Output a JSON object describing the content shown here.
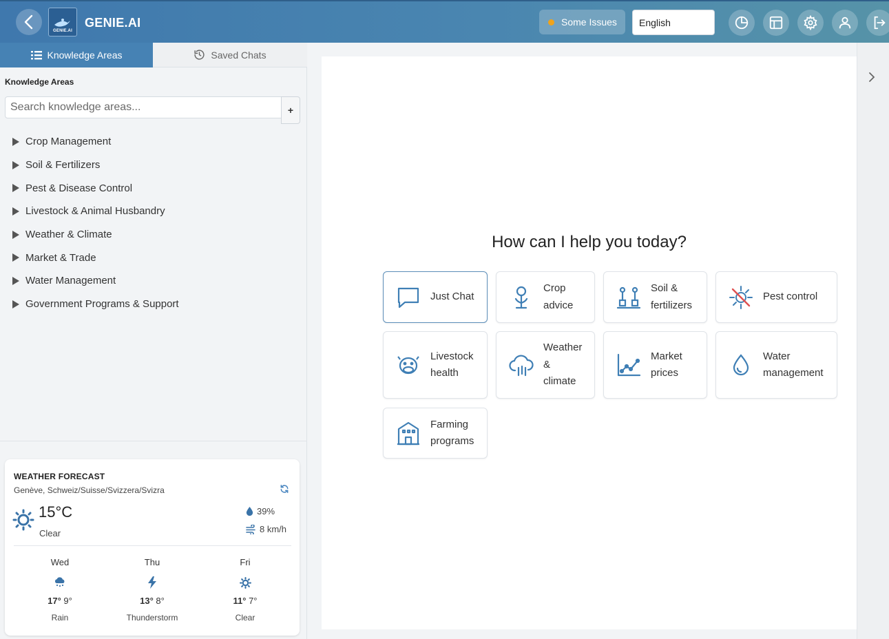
{
  "header": {
    "brand": "GENIE.AI",
    "logo_text": "GENIE.AI",
    "status_label": "Some Issues",
    "status_color": "#f0a31a",
    "language": "English",
    "icons": [
      "back-icon",
      "chart-icon",
      "layout-icon",
      "gear-icon",
      "user-icon",
      "logout-icon"
    ]
  },
  "sidebar": {
    "tabs": [
      {
        "label": "Knowledge Areas",
        "icon": "list-icon",
        "active": true
      },
      {
        "label": "Saved Chats",
        "icon": "history-icon",
        "active": false
      }
    ],
    "section_title": "Knowledge Areas",
    "search_placeholder": "Search knowledge areas...",
    "add_label": "+",
    "knowledge_areas": [
      "Crop Management",
      "Soil & Fertilizers",
      "Pest & Disease Control",
      "Livestock & Animal Husbandry",
      "Weather & Climate",
      "Market & Trade",
      "Water Management",
      "Government Programs & Support"
    ]
  },
  "weather": {
    "title": "WEATHER FORECAST",
    "location": "Genève, Schweiz/Suisse/Svizzera/Svizra",
    "temperature": "15°C",
    "condition": "Clear",
    "humidity": "39%",
    "wind": "8 km/h",
    "forecast": [
      {
        "day": "Wed",
        "icon": "rain-icon",
        "high": "17°",
        "low": "9°",
        "condition": "Rain"
      },
      {
        "day": "Thu",
        "icon": "thunderstorm-icon",
        "high": "13°",
        "low": "8°",
        "condition": "Thunderstorm"
      },
      {
        "day": "Fri",
        "icon": "sun-icon",
        "high": "11°",
        "low": "7°",
        "condition": "Clear"
      }
    ]
  },
  "main": {
    "greeting": "How can I help you today?",
    "cards": [
      {
        "label_lines": [
          "Just Chat"
        ],
        "icon": "chat-icon",
        "selected": true
      },
      {
        "label_lines": [
          "Crop",
          "advice"
        ],
        "icon": "sprout-icon",
        "selected": false
      },
      {
        "label_lines": [
          "Soil &",
          "fertilizers"
        ],
        "icon": "soil-icon",
        "selected": false
      },
      {
        "label_lines": [
          "Pest control"
        ],
        "icon": "pest-icon",
        "selected": false
      },
      {
        "label_lines": [
          "Livestock",
          "health"
        ],
        "icon": "livestock-icon",
        "selected": false
      },
      {
        "label_lines": [
          "Weather",
          "&",
          "climate"
        ],
        "icon": "weather-icon",
        "selected": false
      },
      {
        "label_lines": [
          "Market",
          "prices"
        ],
        "icon": "market-icon",
        "selected": false
      },
      {
        "label_lines": [
          "Water",
          "management"
        ],
        "icon": "water-icon",
        "selected": false
      },
      {
        "label_lines": [
          "Farming",
          "programs"
        ],
        "icon": "building-icon",
        "selected": false
      }
    ]
  }
}
